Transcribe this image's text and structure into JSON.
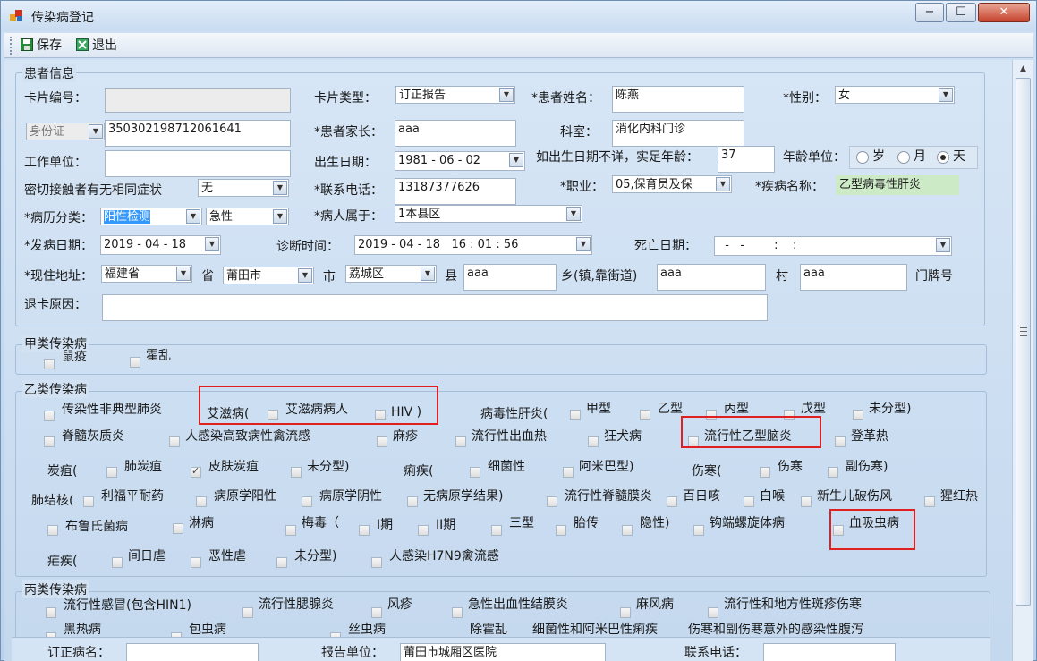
{
  "window": {
    "title": "传染病登记",
    "btn_min": "−",
    "btn_max": "☐",
    "btn_close": "✕"
  },
  "toolbar": {
    "save": "保存",
    "exit": "退出"
  },
  "patient": {
    "group_title": "患者信息",
    "card_no_label": "卡片编号：",
    "card_no_value": "",
    "card_type_label": "卡片类型：",
    "card_type_value": "订正报告",
    "name_label": "*患者姓名：",
    "name_value": "陈燕",
    "gender_label": "*性别：",
    "gender_value": "女",
    "id_type": "身份证",
    "id_value": "350302198712061641",
    "parent_label": "*患者家长：",
    "parent_value": "aaa",
    "dept_label": "科室：",
    "dept_value": "消化内科门诊",
    "work_label": "工作单位：",
    "work_value": "",
    "birth_label": "出生日期：",
    "birth_value": "1981 - 06 - 02",
    "age_unknown_label": "如出生日期不详，实足年龄：",
    "age_value": "37",
    "age_unit_label": "年龄单位：",
    "age_unit_sui": "岁",
    "age_unit_yue": "月",
    "age_unit_tian": "天",
    "contact_symptom_label": "密切接触者有无相同症状",
    "contact_symptom_value": "无",
    "phone_label": "*联系电话：",
    "phone_value": "13187377626",
    "job_label": "*职业：",
    "job_value": "05,保育员及保",
    "disease_label": "*疾病名称：",
    "disease_value": "乙型病毒性肝炎",
    "case_type_label": "*病历分类：",
    "case_type_value": "阳性检测",
    "case_type2_value": "急性",
    "belongs_label": "*病人属于：",
    "belongs_value": "1本县区",
    "onset_label": "*发病日期：",
    "onset_value": "2019 - 04 - 18",
    "diag_label": "诊断时间：",
    "diag_value": "2019 - 04 - 18   16 : 01 : 56",
    "death_label": "死亡日期：",
    "death_value": "  -   -        :    :",
    "addr_label": "*现住地址：",
    "province_value": "福建省",
    "province_unit": "省",
    "city_value": "莆田市",
    "city_unit": "市",
    "county_value": "荔城区",
    "county_unit": "县",
    "town_value": "aaa",
    "town_unit": "乡(镇,靠街道)",
    "village_value": "aaa",
    "village_unit": "村",
    "house_value": "aaa",
    "house_unit": "门牌号",
    "return_label": "退卡原因：",
    "return_value": ""
  },
  "classA": {
    "title": "甲类传染病",
    "items": [
      "鼠疫",
      "霍乱"
    ]
  },
  "classB": {
    "title": "乙类传染病",
    "sars": "传染性非典型肺炎",
    "aids_label": "艾滋病(",
    "aids_patient": "艾滋病病人",
    "aids_hiv": "HIV",
    "hep_label": "病毒性肝炎(",
    "hep_a": "甲型",
    "hep_b": "乙型",
    "hep_c": "丙型",
    "hep_e": "戊型",
    "hep_u": "未分型)",
    "polio": "脊髓灰质炎",
    "h5n1": "人感染高致病性禽流感",
    "measles": "麻疹",
    "hfrs": "流行性出血热",
    "rabies": "狂犬病",
    "jev": "流行性乙型脑炎",
    "dengue": "登革热",
    "anthrax_label": "炭疽(",
    "anthrax_lung": "肺炭疽",
    "anthrax_skin": "皮肤炭疽",
    "anthrax_u": "未分型)",
    "dysentery_label": "痢疾(",
    "dys_bac": "细菌性",
    "dys_amoeba": "阿米巴型)",
    "typhoid_label": "伤寒(",
    "typhoid": "伤寒",
    "paratyphoid": "副伤寒)",
    "tb_label": "肺结核(",
    "tb_rif": "利福平耐药",
    "tb_pos": "病原学阳性",
    "tb_neg": "病原学阴性",
    "tb_none": "无病原学结果)",
    "meningitis": "流行性脊髓膜炎",
    "pertussis": "百日咳",
    "diphtheria": "白喉",
    "neonatal_tetanus": "新生儿破伤风",
    "scarlet": "猩红热",
    "brucella": "布鲁氏菌病",
    "gonorrhea": "淋病",
    "syphilis_label": "梅毒（",
    "syph1": "I期",
    "syph2": "II期",
    "syph3": "三型",
    "syph_fetal": "胎传",
    "syph_latent": "隐性)",
    "lepto": "钩端螺旋体病",
    "schisto": "血吸虫病",
    "malaria_label": "疟疾(",
    "mal_vivax": "间日虐",
    "mal_falc": "恶性虐",
    "mal_u": "未分型)",
    "h7n9": "人感染H7N9禽流感"
  },
  "classC": {
    "title": "丙类传染病",
    "flu": "流行性感冒(包含HIN1)",
    "mumps": "流行性腮腺炎",
    "rubella": "风疹",
    "conjunctivitis": "急性出血性结膜炎",
    "leprosy": "麻风病",
    "typhus": "流行性和地方性斑疹伤寒",
    "row2": [
      "黑热病",
      "包虫病",
      "丝虫病",
      "除霍乱",
      "细菌性和阿米巴性痢疾",
      "伤寒和副伤寒意外的感染性腹泻"
    ]
  },
  "bottom": {
    "corrector_label": "订正病名：",
    "reporter_label": "报告单位：",
    "reporter_value": "莆田市城厢区医院",
    "phone_label": "联系电话："
  }
}
